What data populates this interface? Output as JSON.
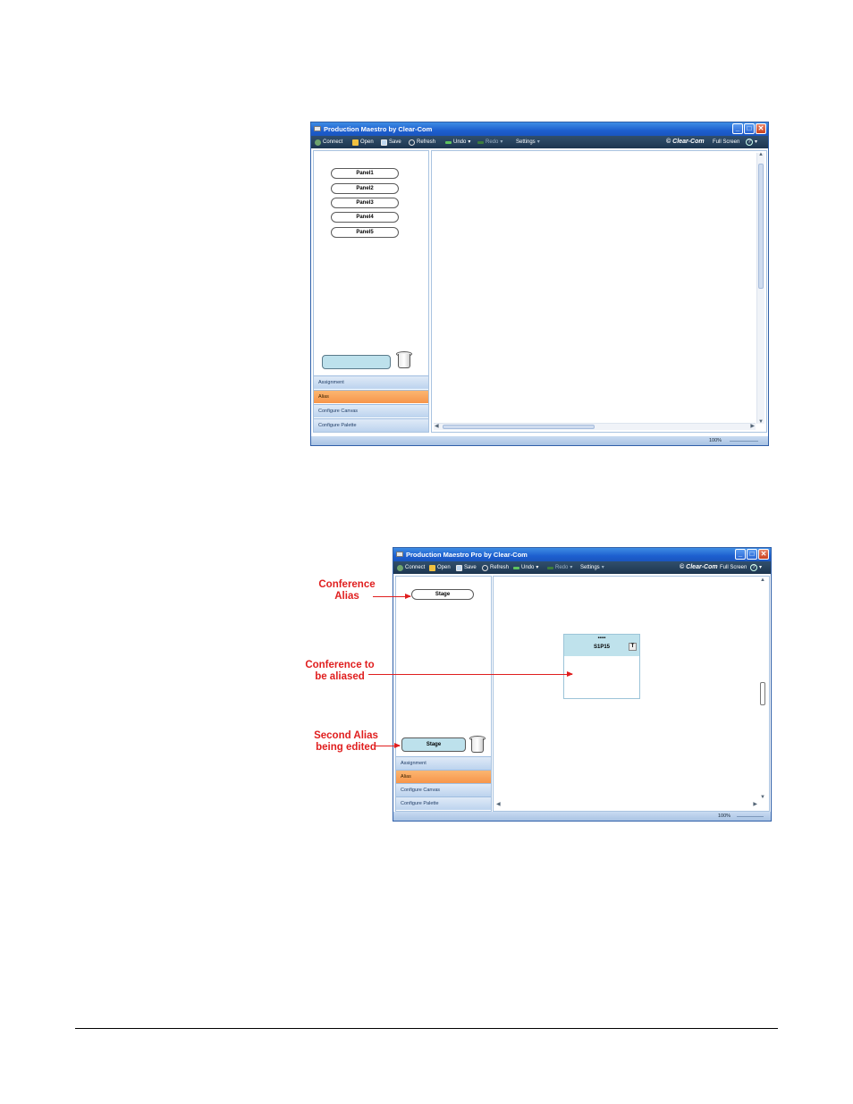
{
  "screenshot1": {
    "title": "Production Maestro by Clear-Com",
    "toolbar": {
      "connect": "Connect",
      "open": "Open",
      "save": "Save",
      "refresh": "Refresh",
      "undo": "Undo",
      "redo": "Redo",
      "settings": "Settings",
      "brand": "Clear-Com",
      "fullscreen": "Full Screen",
      "help": "?"
    },
    "panels": [
      "Panel1",
      "Panel2",
      "Panel3",
      "Panel4",
      "Panel5"
    ],
    "accordion": [
      "Assignment",
      "Alias",
      "Configure Canvas",
      "Configure Palette"
    ],
    "active_section": "Alias",
    "zoom": "100%"
  },
  "screenshot2": {
    "title": "Production Maestro Pro by Clear-Com",
    "toolbar": {
      "connect": "Connect",
      "open": "Open",
      "save": "Save",
      "refresh": "Refresh",
      "undo": "Undo",
      "redo": "Redo",
      "settings": "Settings",
      "brand": "Clear-Com",
      "fullscreen": "Full Screen",
      "help": "?"
    },
    "alias_pill": "Stage",
    "editing_pill": "Stage",
    "conference": {
      "dots": "•••••",
      "name": "S1P15",
      "button": "T"
    },
    "accordion": [
      "Assignment",
      "Alias",
      "Configure Canvas",
      "Configure Palette"
    ],
    "active_section": "Alias",
    "zoom": "100%"
  },
  "callouts": {
    "conference_alias": [
      "Conference",
      "Alias"
    ],
    "to_be_aliased": [
      "Conference to",
      "be aliased"
    ],
    "second_alias": [
      "Second Alias",
      "being edited"
    ]
  },
  "colors": {
    "title_bar": "#1d5fcf",
    "toolbar": "#1d3650",
    "accordion": "#bcd3ee",
    "accordion_active": "#f7954a",
    "callout_red": "#e01f1f",
    "conference_header": "#bfe2ec"
  }
}
